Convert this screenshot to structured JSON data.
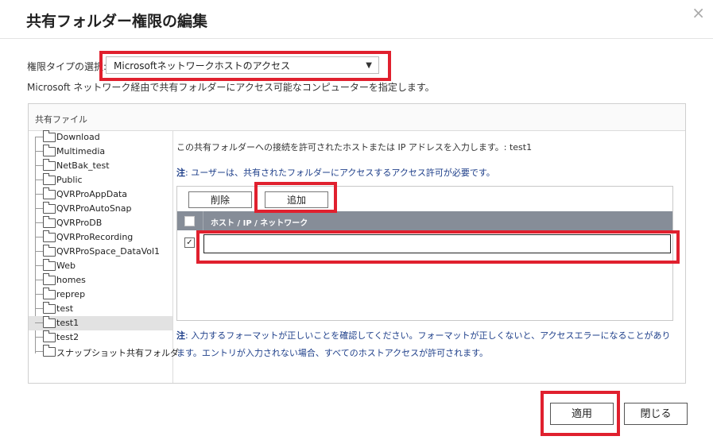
{
  "dialog": {
    "title": "共有フォルダー権限の編集",
    "close_glyph": "×"
  },
  "permission": {
    "label": "権限タイプの選択:",
    "selected": "Microsoftネットワークホストのアクセス",
    "arrow_glyph": "▼"
  },
  "description": "Microsoft ネットワーク経由で共有フォルダーにアクセス可能なコンピューターを指定します。",
  "shared_files": {
    "header": "共有ファイル",
    "folders": [
      {
        "label": "Download",
        "selected": false
      },
      {
        "label": "Multimedia",
        "selected": false
      },
      {
        "label": "NetBak_test",
        "selected": false
      },
      {
        "label": "Public",
        "selected": false
      },
      {
        "label": "QVRProAppData",
        "selected": false
      },
      {
        "label": "QVRProAutoSnap",
        "selected": false
      },
      {
        "label": "QVRProDB",
        "selected": false
      },
      {
        "label": "QVRProRecording",
        "selected": false
      },
      {
        "label": "QVRProSpace_DataVol1",
        "selected": false
      },
      {
        "label": "Web",
        "selected": false
      },
      {
        "label": "homes",
        "selected": false
      },
      {
        "label": "reprep",
        "selected": false
      },
      {
        "label": "test",
        "selected": false
      },
      {
        "label": "test1",
        "selected": true
      },
      {
        "label": "test2",
        "selected": false
      },
      {
        "label": "スナップショット共有フォルダ",
        "selected": false
      }
    ]
  },
  "hosts": {
    "info": "この共有フォルダーへの接続を許可されたホストまたは IP アドレスを入力します。: test1",
    "note_label": "注",
    "note_text": ": ユーザーは、共有されたフォルダーにアクセスするアクセス許可が必要です。",
    "delete_label": "削除",
    "add_label": "追加",
    "column_header": "ホスト / IP / ネットワーク",
    "row_checked_glyph": "✓",
    "input_value": "",
    "note2_label": "注",
    "note2_text": ": 入力するフォーマットが正しいことを確認してください。フォーマットが正しくないと、アクセスエラーになることがあります。エントリが入力されない場合、すべてのホストアクセスが許可されます。"
  },
  "footer": {
    "apply_label": "適用",
    "close_label": "閉じる"
  },
  "colors": {
    "highlight_red": "#e0202e",
    "grid_header": "#868d98",
    "note_blue": "#1e3f8a"
  }
}
